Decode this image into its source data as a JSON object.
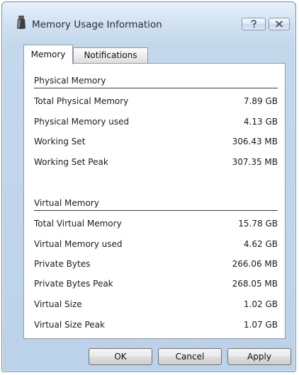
{
  "window": {
    "title": "Memory Usage Information",
    "title_icon": "app-icon",
    "help_icon": "help-question-icon",
    "close_icon": "close-x-icon"
  },
  "tabs": [
    {
      "label": "Memory",
      "active": true
    },
    {
      "label": "Notifications",
      "active": false
    }
  ],
  "physical": {
    "title": "Physical Memory",
    "rows": [
      {
        "label": "Total Physical Memory",
        "value": "7.89 GB"
      },
      {
        "label": "Physical Memory used",
        "value": "4.13 GB"
      },
      {
        "label": "Working Set",
        "value": "306.43 MB"
      },
      {
        "label": "Working Set Peak",
        "value": "307.35 MB"
      }
    ]
  },
  "virtual": {
    "title": "Virtual Memory",
    "rows": [
      {
        "label": "Total Virtual Memory",
        "value": "15.78 GB"
      },
      {
        "label": "Virtual Memory used",
        "value": "4.62 GB"
      },
      {
        "label": "Private Bytes",
        "value": "266.06 MB"
      },
      {
        "label": "Private Bytes Peak",
        "value": "268.05 MB"
      },
      {
        "label": "Virtual Size",
        "value": "1.02 GB"
      },
      {
        "label": "Virtual Size Peak",
        "value": "1.07 GB"
      }
    ]
  },
  "buttons": {
    "ok": "OK",
    "cancel": "Cancel",
    "apply": "Apply"
  }
}
